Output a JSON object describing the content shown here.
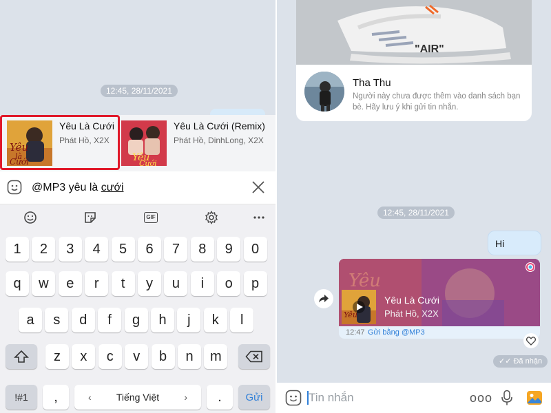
{
  "left": {
    "timestamp": "12:45, 28/11/2021",
    "suggestions": [
      {
        "title": "Yêu Là Cưới",
        "artist": "Phát Hồ, X2X"
      },
      {
        "title": "Yêu Là Cưới (Remix)",
        "artist": "Phát Hồ, DinhLong, X2X"
      }
    ],
    "input": {
      "prefix": "@MP3 yêu là ",
      "underlined": "cưới"
    },
    "keyboard": {
      "tools": [
        "emoji-icon",
        "sticker-icon",
        "gif-icon",
        "settings-icon",
        "more-icon"
      ],
      "gif_label": "GIF",
      "row_numbers": [
        "1",
        "2",
        "3",
        "4",
        "5",
        "6",
        "7",
        "8",
        "9",
        "0"
      ],
      "row1": [
        "q",
        "w",
        "e",
        "r",
        "t",
        "y",
        "u",
        "i",
        "o",
        "p"
      ],
      "row2": [
        "a",
        "s",
        "d",
        "f",
        "g",
        "h",
        "j",
        "k",
        "l"
      ],
      "row3": [
        "z",
        "x",
        "c",
        "v",
        "b",
        "n",
        "m"
      ],
      "symbols_key": "!#1",
      "comma_key": ",",
      "language_label": "Tiếng Việt",
      "period_key": ".",
      "send_key": "Gửi"
    }
  },
  "right": {
    "profile": {
      "name": "Tha Thu",
      "note": "Người này chưa được thêm vào danh sách bạn bè. Hãy lưu ý khi gửi tin nhắn.",
      "shoe_text": "\"AIR\""
    },
    "timestamp": "12:45, 28/11/2021",
    "hi_message": "Hi",
    "music": {
      "title": "Yêu Là Cưới",
      "artist": "Phát Hồ, X2X",
      "time": "12:47",
      "via": "Gửi bằng @MP3"
    },
    "status": "✓✓ Đã nhận",
    "composer_placeholder": "Tin nhắn",
    "more_label": "ooo"
  },
  "colors": {
    "accent": "#2f7fd8",
    "highlight": "#e0192a",
    "chat_bg": "#dce2ea"
  }
}
